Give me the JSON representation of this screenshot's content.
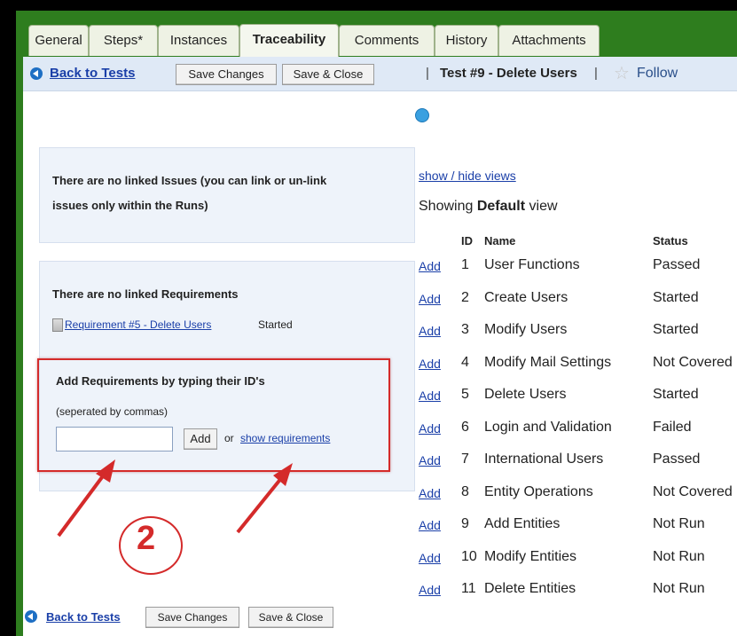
{
  "tabs": [
    "General",
    "Steps*",
    "Instances",
    "Traceability",
    "Comments",
    "History",
    "Attachments"
  ],
  "active_tab": "Traceability",
  "toolbar": {
    "back_label": "Back to Tests",
    "save_changes": "Save Changes",
    "save_close": "Save & Close",
    "separator": "|",
    "test_title": "Test #9 - Delete Users",
    "follow_label": "Follow"
  },
  "issues_panel": {
    "line1": "There are no linked Issues (you can link or un-link",
    "line2": "issues only within the Runs)"
  },
  "requirements_panel": {
    "title": "There are no linked Requirements",
    "req_link": "Requirement #5 - Delete Users",
    "req_status": "Started",
    "add_title": "Add Requirements by typing their ID's",
    "add_hint": "(seperated by commas)",
    "add_input_value": "",
    "add_button": "Add",
    "or_text": "or",
    "show_link": "show requirements"
  },
  "views": {
    "toggle_link": "show / hide views",
    "showing_prefix": "Showing",
    "view_name": "Default",
    "showing_suffix": "view"
  },
  "columns": {
    "id": "ID",
    "name": "Name",
    "status": "Status"
  },
  "row_add_label": "Add",
  "rows": [
    {
      "id": "1",
      "name": "User Functions",
      "status": "Passed"
    },
    {
      "id": "2",
      "name": "Create Users",
      "status": "Started"
    },
    {
      "id": "3",
      "name": "Modify Users",
      "status": "Started"
    },
    {
      "id": "4",
      "name": "Modify Mail Settings",
      "status": "Not Covered"
    },
    {
      "id": "5",
      "name": "Delete Users",
      "status": "Started"
    },
    {
      "id": "6",
      "name": "Login and Validation",
      "status": "Failed"
    },
    {
      "id": "7",
      "name": "International Users",
      "status": "Passed"
    },
    {
      "id": "8",
      "name": "Entity Operations",
      "status": "Not Covered"
    },
    {
      "id": "9",
      "name": "Add Entities",
      "status": "Not Run"
    },
    {
      "id": "10",
      "name": "Modify Entities",
      "status": "Not Run"
    },
    {
      "id": "11",
      "name": "Delete Entities",
      "status": "Not Run"
    }
  ],
  "bottom_toolbar": {
    "back_label": "Back to Tests",
    "save_changes": "Save Changes",
    "save_close": "Save & Close"
  },
  "annotation_number": "2",
  "colors": {
    "header_green": "#2e7d1e",
    "toolbar_blue": "#dfe9f6",
    "panel_blue": "#eef3fa",
    "link_blue": "#1a3fa8",
    "annotation_red": "#d42a2a"
  }
}
